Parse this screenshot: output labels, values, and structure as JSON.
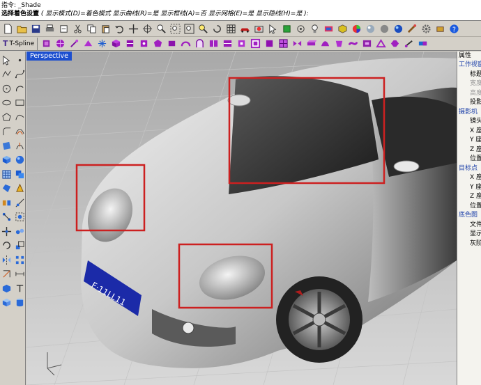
{
  "command": {
    "line1_prefix": "指令:",
    "line1_value": "_Shade",
    "line2_prompt": "选择着色设置",
    "line2_options": "( 显示模式(D)=着色模式  显示曲线(R)=是  显示框线(A)=否  显示网格(E)=是  显示隐线(H)=是 ):"
  },
  "toolbar": {
    "tsplines_label": "T-Spline"
  },
  "viewport": {
    "tab_label": "Perspective",
    "plate_text": "F·11LL11"
  },
  "properties_panel": {
    "title": "属性",
    "rows": [
      {
        "kind": "head",
        "text": "工作视窗"
      },
      {
        "kind": "item",
        "text": "标题"
      },
      {
        "kind": "dim",
        "text": "宽度"
      },
      {
        "kind": "dim",
        "text": "高度"
      },
      {
        "kind": "item",
        "text": "投影"
      },
      {
        "kind": "head",
        "text": "摄影机"
      },
      {
        "kind": "item",
        "text": "镜头"
      },
      {
        "kind": "item",
        "text": "X 座"
      },
      {
        "kind": "item",
        "text": "Y 座"
      },
      {
        "kind": "item",
        "text": "Z 座"
      },
      {
        "kind": "item",
        "text": "位置"
      },
      {
        "kind": "head",
        "text": "目标点"
      },
      {
        "kind": "item",
        "text": "X 座"
      },
      {
        "kind": "item",
        "text": "Y 座"
      },
      {
        "kind": "item",
        "text": "Z 座"
      },
      {
        "kind": "item",
        "text": "位置"
      },
      {
        "kind": "head",
        "text": "底色图"
      },
      {
        "kind": "item",
        "text": "文件"
      },
      {
        "kind": "item",
        "text": "显示"
      },
      {
        "kind": "item",
        "text": "灰阶"
      }
    ]
  },
  "colors": {
    "highlight_box": "#cc2020",
    "viewport_tab": "#1c4fcf",
    "plate": "#1b2aa8"
  }
}
